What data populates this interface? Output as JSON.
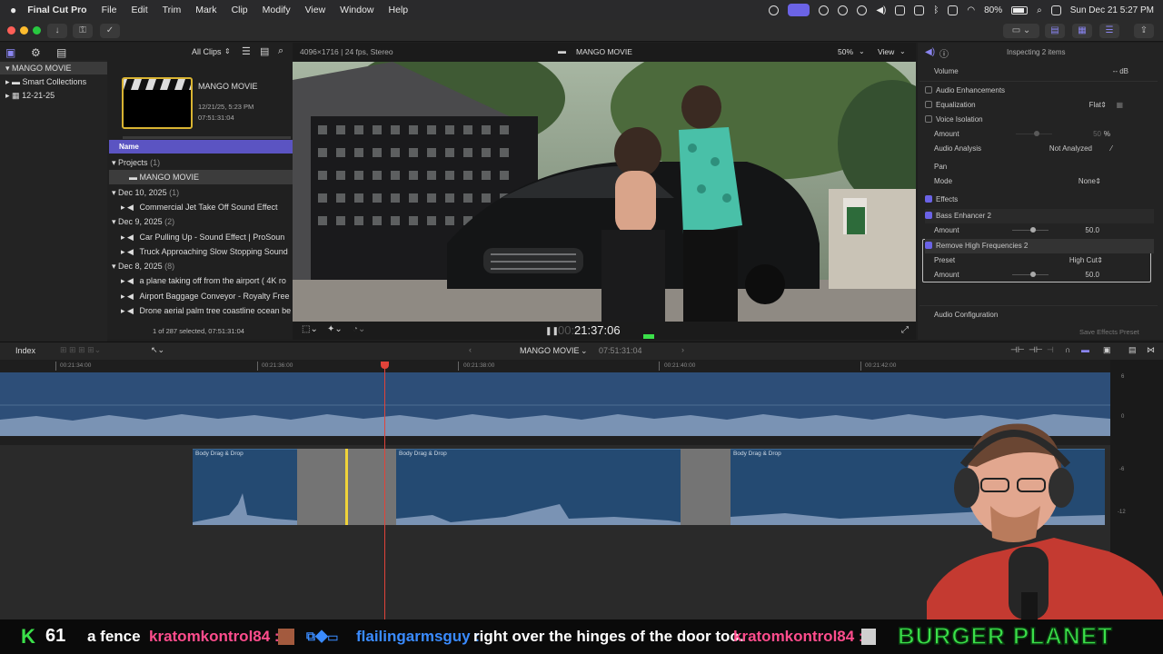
{
  "menubar": {
    "app": "Final Cut Pro",
    "items": [
      "File",
      "Edit",
      "Trim",
      "Mark",
      "Clip",
      "Modify",
      "View",
      "Window",
      "Help"
    ],
    "battery": "80%",
    "datetime": "Sun Dec 21  5:27 PM"
  },
  "browser": {
    "filter": "All Clips",
    "libraries": [
      {
        "label": "MANGO MOVIE"
      },
      {
        "label": "Smart Collections"
      },
      {
        "label": "12-21-25"
      }
    ],
    "clip": {
      "title": "MANGO MOVIE",
      "date": "12/21/25, 5:23 PM",
      "duration": "07:51:31:04"
    },
    "column_name": "Name",
    "rows": [
      {
        "type": "group",
        "label": "Projects",
        "count": "(1)"
      },
      {
        "type": "item",
        "label": "MANGO MOVIE",
        "selected": true
      },
      {
        "type": "group",
        "label": "Dec 10, 2025",
        "count": "(1)"
      },
      {
        "type": "item",
        "label": "Commercial Jet Take Off Sound Effect"
      },
      {
        "type": "group",
        "label": "Dec 9, 2025",
        "count": "(2)"
      },
      {
        "type": "item",
        "label": "Car Pulling Up - Sound Effect  |  ProSoun"
      },
      {
        "type": "item",
        "label": "Truck Approaching Slow Stopping Sound"
      },
      {
        "type": "group",
        "label": "Dec 8, 2025",
        "count": "(8)"
      },
      {
        "type": "item",
        "label": "a plane taking off from the airport ( 4K ro"
      },
      {
        "type": "item",
        "label": "Airport Baggage Conveyor - Royalty Free"
      },
      {
        "type": "item",
        "label": "Drone aerial palm tree coastline ocean be"
      }
    ],
    "status": "1 of 287 selected, 07:51:31:04"
  },
  "viewer": {
    "format": "4096×1716 | 24 fps, Stereo",
    "title": "MANGO MOVIE",
    "zoom": "50%",
    "view": "View",
    "timecode": "21:37:06",
    "timecode_dim": "00:"
  },
  "inspector": {
    "header": "Inspecting 2 items",
    "volume_label": "Volume",
    "volume_value": "-- dB",
    "audio_enh": "Audio Enhancements",
    "equalization": "Equalization",
    "eq_value": "Flat",
    "voice_iso": "Voice Isolation",
    "amount": "Amount",
    "vi_amount": "50",
    "pct": "%",
    "analysis": "Audio Analysis",
    "analysis_value": "Not Analyzed",
    "pan": "Pan",
    "mode": "Mode",
    "mode_value": "None",
    "effects": "Effects",
    "bass": "Bass Enhancer 2",
    "bass_amount": "50.0",
    "rhf": "Remove High Frequencies 2",
    "preset": "Preset",
    "preset_value": "High Cut",
    "rhf_amount": "50.0",
    "audio_config": "Audio Configuration",
    "save_preset": "Save Effects Preset"
  },
  "timeline": {
    "index": "Index",
    "project": "MANGO MOVIE",
    "duration": "07:51:31:04",
    "ruler": [
      "00:21:34:00",
      "00:21:36:00",
      "00:21:38:00",
      "00:21:40:00",
      "00:21:42:00"
    ],
    "clips": [
      "Body Drag & Drop",
      "Body Drag & Drop",
      "Body Drag & Drop"
    ],
    "meter": [
      "6",
      "0",
      "-6",
      "-12"
    ]
  },
  "ticker": {
    "count": "61",
    "msg1": "a fence",
    "user1": "kratomkontrol84 :",
    "user2": "flailingarmsguy :",
    "msg2": "right over the hinges of the door too.",
    "user3": "kratomkontrol84 :",
    "brand": "BURGER PLANET"
  },
  "colors": {
    "accent": "#5b54c2",
    "ticker_green": "#3be04a",
    "ticker_pink": "#ff4d8d",
    "ticker_blue": "#3a8bff",
    "playhead": "#e0433a"
  }
}
